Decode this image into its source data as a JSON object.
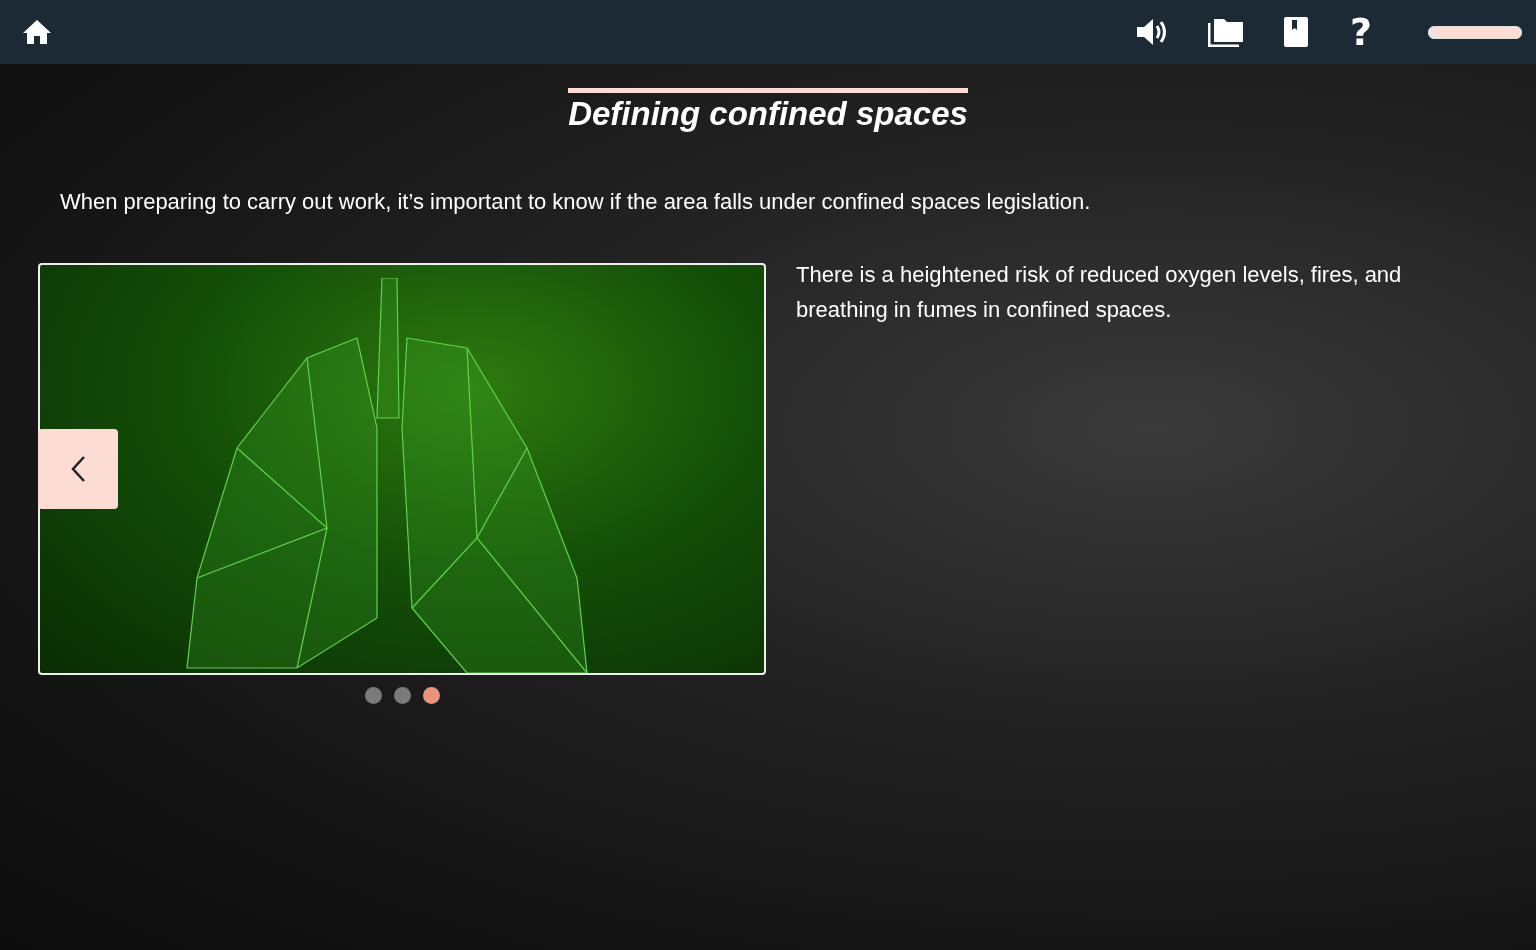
{
  "top_bar": {
    "help_label": "?",
    "progress": {
      "level": 0.96
    }
  },
  "title": "Defining confined spaces",
  "intro": "When preparing to carry out work, it’s important to know if the area falls under confined spaces legislation.",
  "carousel": {
    "slides": [
      {
        "selected": false
      },
      {
        "selected": false
      },
      {
        "selected": true
      }
    ]
  },
  "body": "There is a heightened risk of reduced oxygen levels, fires, and breathing in fumes in confined spaces."
}
